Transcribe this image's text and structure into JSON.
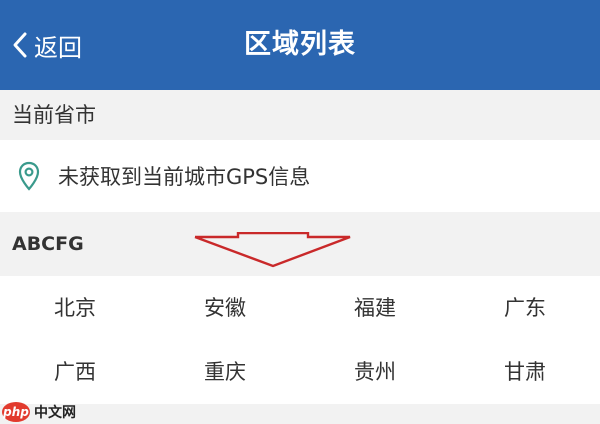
{
  "header": {
    "back_label": "返回",
    "title": "区域列表",
    "background": "#2b66b1"
  },
  "current_section": {
    "label": "当前省市",
    "gps_message": "未获取到当前城市GPS信息"
  },
  "letter_section": {
    "label": "ABCFG"
  },
  "cities": [
    "北京",
    "安徽",
    "福建",
    "广东",
    "广西",
    "重庆",
    "贵州",
    "甘肃"
  ],
  "watermark": {
    "logo": "php",
    "text": "中文网"
  },
  "colors": {
    "accent": "#2b66b1",
    "arrow": "#c9292a",
    "gps_icon": "#3a9a8c"
  }
}
